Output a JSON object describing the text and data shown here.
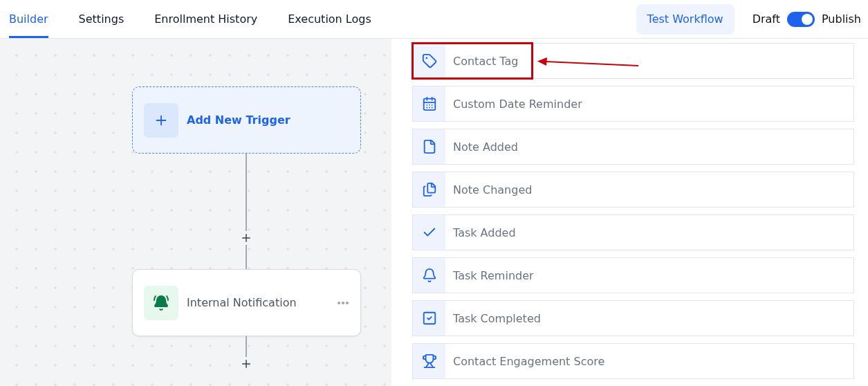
{
  "tabs": [
    {
      "label": "Builder",
      "selected": true
    },
    {
      "label": "Settings",
      "selected": false
    },
    {
      "label": "Enrollment History",
      "selected": false
    },
    {
      "label": "Execution Logs",
      "selected": false
    }
  ],
  "test_button": "Test Workflow",
  "publish_switch": {
    "off_label": "Draft",
    "on_label": "Publish",
    "on": true
  },
  "canvas": {
    "trigger": "Add New Trigger",
    "action": {
      "label": "Internal Notification",
      "kind": "notification"
    }
  },
  "triggers": [
    {
      "label": "Contact Tag",
      "kind": "tag",
      "highlighted": true
    },
    {
      "label": "Custom Date Reminder",
      "kind": "calendar",
      "highlighted": false
    },
    {
      "label": "Note Added",
      "kind": "file",
      "highlighted": false
    },
    {
      "label": "Note Changed",
      "kind": "files",
      "highlighted": false
    },
    {
      "label": "Task Added",
      "kind": "check",
      "highlighted": false
    },
    {
      "label": "Task Reminder",
      "kind": "bell",
      "highlighted": false
    },
    {
      "label": "Task Completed",
      "kind": "checkbox",
      "highlighted": false
    },
    {
      "label": "Contact Engagement Score",
      "kind": "trophy",
      "highlighted": false
    }
  ]
}
